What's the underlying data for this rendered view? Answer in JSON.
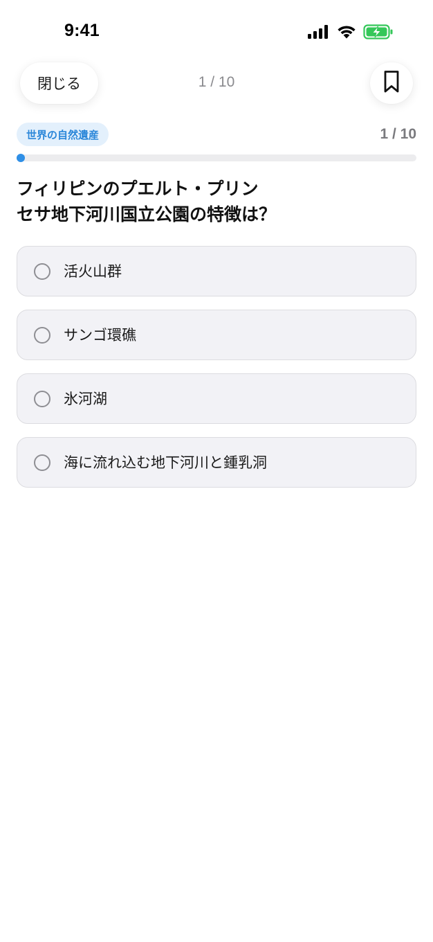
{
  "status_bar": {
    "time": "9:41",
    "icons": [
      "cellular-signal-icon",
      "wifi-icon",
      "battery-charging-icon"
    ],
    "battery_color": "#34c759"
  },
  "header": {
    "close_label": "閉じる",
    "progress_text": "1 / 10",
    "bookmark_icon": "bookmark-icon"
  },
  "quiz": {
    "category": "世界の自然遺産",
    "counter": "1 / 10",
    "progress": 0.0,
    "question_lines": [
      "フィリピンのプエルト・プリン",
      "セサ地下河川国立公園の特徴は？"
    ],
    "options": [
      "活火山群",
      "サンゴ環礁",
      "氷河湖",
      "海に流れ込む地下河川と鍾乳洞"
    ]
  },
  "colors": {
    "accent": "#2f8fe6",
    "badge_bg": "#e3f0fc",
    "badge_text": "#2b87d9",
    "option_bg": "#f2f2f6",
    "option_border": "#dcdce0"
  }
}
